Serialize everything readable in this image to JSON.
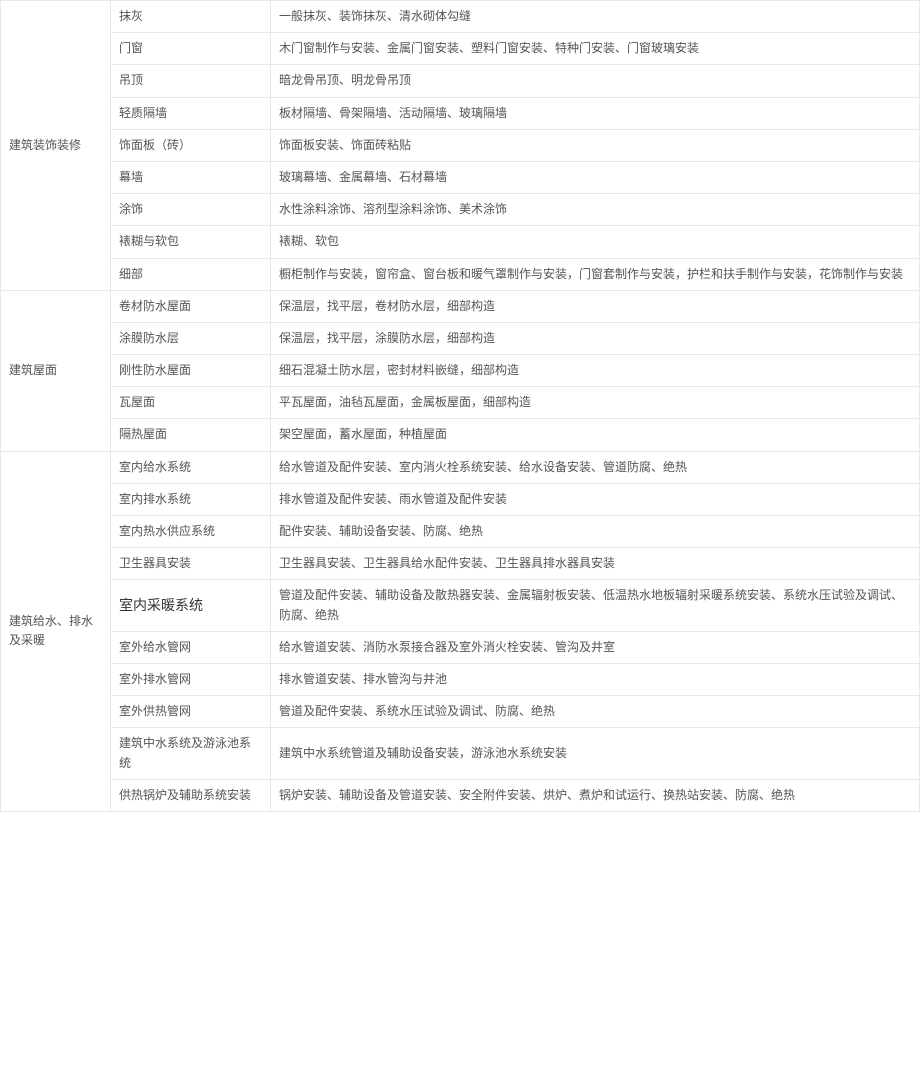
{
  "sections": [
    {
      "category": "建筑装饰装修",
      "rows": [
        {
          "sub": "抹灰",
          "detail": "一般抹灰、装饰抹灰、清水砌体勾缝"
        },
        {
          "sub": "门窗",
          "detail": "木门窗制作与安装、金属门窗安装、塑料门窗安装、特种门安装、门窗玻璃安装"
        },
        {
          "sub": "吊顶",
          "detail": "暗龙骨吊顶、明龙骨吊顶"
        },
        {
          "sub": "轻质隔墙",
          "detail": "板材隔墙、骨架隔墙、活动隔墙、玻璃隔墙"
        },
        {
          "sub": "饰面板（砖）",
          "detail": "饰面板安装、饰面砖粘贴"
        },
        {
          "sub": "幕墙",
          "detail": "玻璃幕墙、金属幕墙、石材幕墙"
        },
        {
          "sub": "涂饰",
          "detail": "水性涂料涂饰、溶剂型涂料涂饰、美术涂饰"
        },
        {
          "sub": "裱糊与软包",
          "detail": "裱糊、软包"
        },
        {
          "sub": "细部",
          "detail": "橱柜制作与安装，窗帘盒、窗台板和暖气罩制作与安装，门窗套制作与安装，护栏和扶手制作与安装，花饰制作与安装"
        }
      ]
    },
    {
      "category": "建筑屋面",
      "rows": [
        {
          "sub": "卷材防水屋面",
          "detail": "保温层，找平层，卷材防水层，细部构造"
        },
        {
          "sub": "涂膜防水层",
          "detail": "保温层，找平层，涂膜防水层，细部构造"
        },
        {
          "sub": "刚性防水屋面",
          "detail": "细石混凝土防水层，密封材料嵌缝，细部构造"
        },
        {
          "sub": "瓦屋面",
          "detail": "平瓦屋面，油毡瓦屋面，金属板屋面，细部构造"
        },
        {
          "sub": "隔热屋面",
          "detail": "架空屋面，蓄水屋面，种植屋面"
        }
      ]
    },
    {
      "category": "建筑给水、排水及采暖",
      "rows": [
        {
          "sub": "室内给水系统",
          "detail": "给水管道及配件安装、室内消火栓系统安装、给水设备安装、管道防腐、绝热"
        },
        {
          "sub": "室内排水系统",
          "detail": "排水管道及配件安装、雨水管道及配件安装"
        },
        {
          "sub": "室内热水供应系统",
          "detail": "配件安装、辅助设备安装、防腐、绝热"
        },
        {
          "sub": "卫生器具安装",
          "detail": "卫生器具安装、卫生器具给水配件安装、卫生器具排水器具安装"
        },
        {
          "sub": "室内采暖系统",
          "big": true,
          "detail": "管道及配件安装、辅助设备及散热器安装、金属辐射板安装、低温热水地板辐射采暖系统安装、系统水压试验及调试、防腐、绝热"
        },
        {
          "sub": "室外给水管网",
          "detail": "给水管道安装、消防水泵接合器及室外消火栓安装、管沟及井室"
        },
        {
          "sub": "室外排水管网",
          "detail": "排水管道安装、排水管沟与井池"
        },
        {
          "sub": "室外供热管网",
          "detail": "管道及配件安装、系统水压试验及调试、防腐、绝热"
        },
        {
          "sub": "建筑中水系统及游泳池系统",
          "detail": "建筑中水系统管道及辅助设备安装，游泳池水系统安装"
        },
        {
          "sub": "供热锅炉及辅助系统安装",
          "detail": "锅炉安装、辅助设备及管道安装、安全附件安装、烘炉、煮炉和试运行、换热站安装、防腐、绝热"
        }
      ]
    }
  ]
}
